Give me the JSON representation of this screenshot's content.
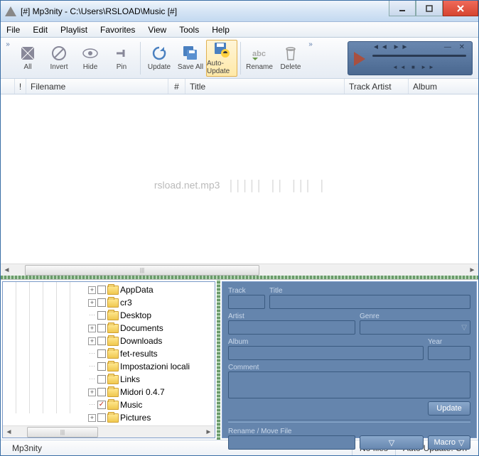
{
  "title": "[#] Mp3nity - C:\\Users\\RSLOAD\\Music [#]",
  "menu": {
    "file": "File",
    "edit": "Edit",
    "playlist": "Playlist",
    "favorites": "Favorites",
    "view": "View",
    "tools": "Tools",
    "help": "Help"
  },
  "toolbar": {
    "all": "All",
    "invert": "Invert",
    "hide": "Hide",
    "pin": "Pin",
    "update": "Update",
    "saveall": "Save All",
    "autoupdate": "Auto-Update",
    "rename": "Rename",
    "delete": "Delete"
  },
  "columns": {
    "excl": "",
    "bang": "!",
    "filename": "Filename",
    "num": "#",
    "title": "Title",
    "artist": "Track Artist",
    "album": "Album"
  },
  "watermark": "rsload.net.mp3",
  "tree": {
    "items": [
      {
        "name": "AppData",
        "expandable": true,
        "checked": false
      },
      {
        "name": "cr3",
        "expandable": true,
        "checked": false
      },
      {
        "name": "Desktop",
        "expandable": false,
        "checked": false
      },
      {
        "name": "Documents",
        "expandable": true,
        "checked": false
      },
      {
        "name": "Downloads",
        "expandable": true,
        "checked": false
      },
      {
        "name": "fet-results",
        "expandable": false,
        "checked": false
      },
      {
        "name": "Impostazioni locali",
        "expandable": false,
        "checked": false
      },
      {
        "name": "Links",
        "expandable": false,
        "checked": false
      },
      {
        "name": "Midori 0.4.7",
        "expandable": true,
        "checked": false
      },
      {
        "name": "Music",
        "expandable": false,
        "checked": true
      },
      {
        "name": "Pictures",
        "expandable": true,
        "checked": false
      }
    ]
  },
  "props": {
    "track_lbl": "Track",
    "title_lbl": "Title",
    "artist_lbl": "Artist",
    "genre_lbl": "Genre",
    "album_lbl": "Album",
    "year_lbl": "Year",
    "comment_lbl": "Comment",
    "rename_lbl": "Rename / Move File",
    "update_btn": "Update",
    "macro_btn": "Macro"
  },
  "status": {
    "app": "Mp3nity",
    "files": "No files",
    "auto": "Auto-Update: On"
  }
}
